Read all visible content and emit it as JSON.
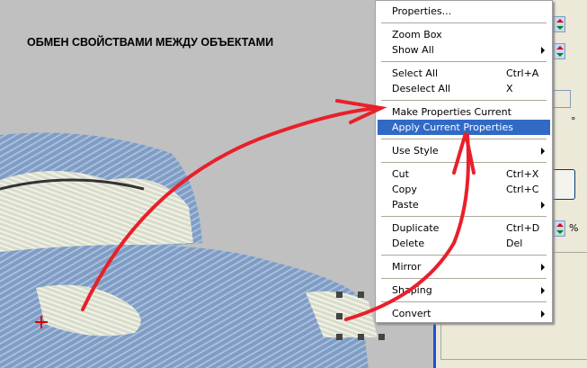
{
  "title": "ОБМЕН СВОЙСТВАМИ МЕЖДУ ОБЪЕКТАМИ",
  "panel": {
    "percent_label": "%",
    "degree_label": "°"
  },
  "menu": {
    "groups": [
      [
        {
          "label": "Properties...",
          "shortcut": "",
          "submenu": false
        }
      ],
      [
        {
          "label": "Zoom Box",
          "shortcut": "",
          "submenu": false
        },
        {
          "label": "Show All",
          "shortcut": "",
          "submenu": true
        }
      ],
      [
        {
          "label": "Select All",
          "shortcut": "Ctrl+A",
          "submenu": false
        },
        {
          "label": "Deselect All",
          "shortcut": "X",
          "submenu": false
        }
      ],
      [
        {
          "label": "Make Properties Current",
          "shortcut": "",
          "submenu": false
        },
        {
          "label": "Apply Current Properties",
          "shortcut": "",
          "submenu": false,
          "highlighted": true
        }
      ],
      [
        {
          "label": "Use Style",
          "shortcut": "",
          "submenu": true
        }
      ],
      [
        {
          "label": "Cut",
          "shortcut": "Ctrl+X",
          "submenu": false
        },
        {
          "label": "Copy",
          "shortcut": "Ctrl+C",
          "submenu": false
        },
        {
          "label": "Paste",
          "shortcut": "",
          "submenu": true
        }
      ],
      [
        {
          "label": "Duplicate",
          "shortcut": "Ctrl+D",
          "submenu": false
        },
        {
          "label": "Delete",
          "shortcut": "Del",
          "submenu": false
        }
      ],
      [
        {
          "label": "Mirror",
          "shortcut": "",
          "submenu": true
        }
      ],
      [
        {
          "label": "Shaping",
          "shortcut": "",
          "submenu": true
        }
      ],
      [
        {
          "label": "Convert",
          "shortcut": "",
          "submenu": true
        }
      ]
    ]
  },
  "colors": {
    "highlight": "#316ac5",
    "arrow": "#e8202a",
    "embroidery": "#7f9cc4"
  }
}
